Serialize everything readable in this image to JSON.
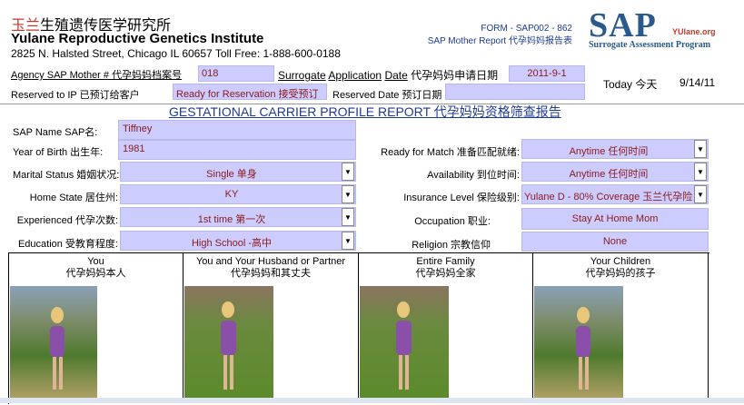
{
  "header": {
    "title_cn_red": "玉兰",
    "title_cn_rest": "生殖遗传医学研究所",
    "title_en": "Yulane Reproductive Genetics Institute",
    "address": "2825 N. Halsted Street, Chicago IL 60657  Toll Free: 1-888-600-0188",
    "form_code": "FORM - SAP002 - 862",
    "form_name": "SAP Mother Report 代孕妈妈报告表",
    "logo_sap": "SAP",
    "logo_yulane": "YUlane.org",
    "logo_sub": "Surrogate Assessment Program"
  },
  "meta": {
    "agency_label": "Agency SAP Mother # 代孕妈妈档案号",
    "agency_value": "018",
    "app_date_label_1": "Surrogate",
    "app_date_label_2": "Application",
    "app_date_label_3": "Date",
    "app_date_label_cn": "代孕妈妈申请日期",
    "app_date_value": "2011-9-1",
    "today_label": "Today 今天",
    "today_value": "9/14/11",
    "reserved_ip_label": "Reserved to IP 已预订给客户",
    "reserved_ip_value": "Ready for Reservation 接受预订",
    "reserved_date_label": "Reserved Date 预订日期",
    "reserved_date_value": ""
  },
  "report_title": "GESTATIONAL CARRIER PROFILE REPORT 代孕妈妈资格筛查报告",
  "left_fields": {
    "name_label": "SAP Name SAP名:",
    "name_value": "Tiffney",
    "yob_label": "Year of Birth 出生年:",
    "yob_value": "1981",
    "marital_label": "Marital Status 婚姻状况:",
    "marital_value": "Single 单身",
    "home_label": "Home State 居住州:",
    "home_value": "KY",
    "exp_label": "Experienced 代孕次数:",
    "exp_value": "1st time 第一次",
    "edu_label": "Education 受教育程度:",
    "edu_value": "High School -高中"
  },
  "right_fields": {
    "ready_label": "Ready for Match 准备匹配就绪:",
    "ready_value": "Anytime 任何时间",
    "avail_label": "Availability 到位时间:",
    "avail_value": "Anytime 任何时间",
    "ins_label": "Insurance Level 保险级别:",
    "ins_value": "Yulane D - 80% Coverage 玉兰代孕险",
    "occ_label": "Occupation 职业:",
    "occ_value": "Stay At Home Mom",
    "rel_label": "Religion 宗教信仰",
    "rel_value": "None"
  },
  "photos": [
    {
      "en": "You",
      "cn": "代孕妈妈本人"
    },
    {
      "en": "You and Your Husband or Partner",
      "cn": "代孕妈妈和其丈夫"
    },
    {
      "en": "Entire Family",
      "cn": "代孕妈妈全家"
    },
    {
      "en": "Your Children",
      "cn": "代孕妈妈的孩子"
    }
  ],
  "colors": {
    "field_bg": "#ccccff",
    "value_text": "#8b1a1a",
    "brand_blue": "#2a5a8c",
    "brand_red": "#c0392b"
  }
}
